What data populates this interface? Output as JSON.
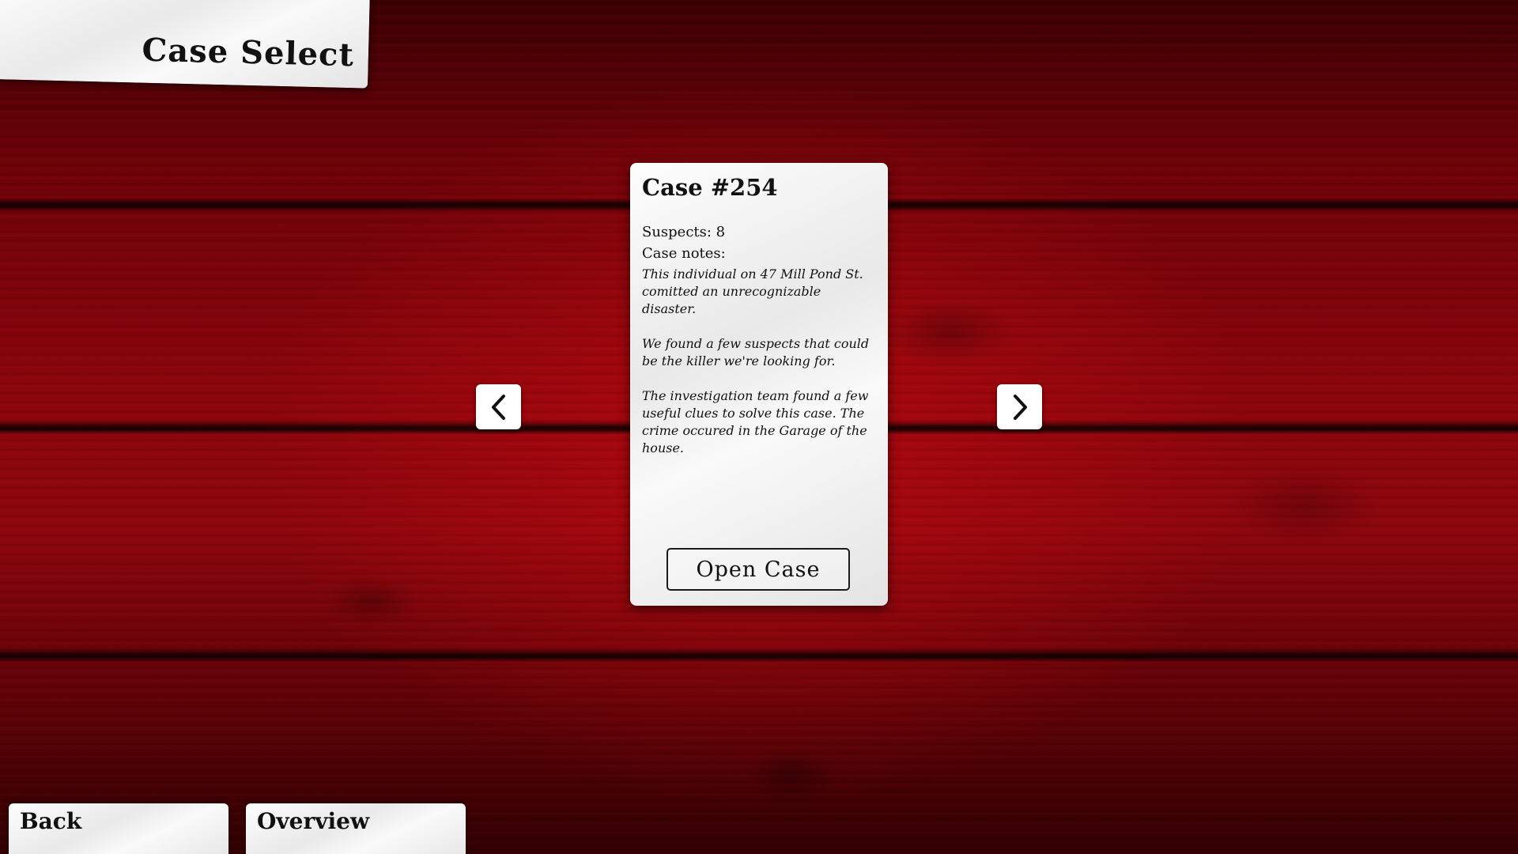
{
  "header": {
    "title": "Case Select"
  },
  "case": {
    "title": "Case #254",
    "suspects": "Suspects: 8",
    "notes_label": "Case notes:",
    "notes": [
      "This individual on 47 Mill Pond St. comitted an unrecognizable disaster.",
      "We found a few suspects that could be the killer we're looking for.",
      "The investigation team found a few useful clues to solve this case. The crime occured in the Garage of the house."
    ],
    "open_label": "Open Case"
  },
  "navigation": {
    "prev_icon": "chevron-left-icon",
    "next_icon": "chevron-right-icon"
  },
  "footer": {
    "back_label": "Back",
    "overview_label": "Overview"
  },
  "colors": {
    "background": "#8a050c",
    "paper": "#f2f2f2",
    "ink": "#111111"
  }
}
